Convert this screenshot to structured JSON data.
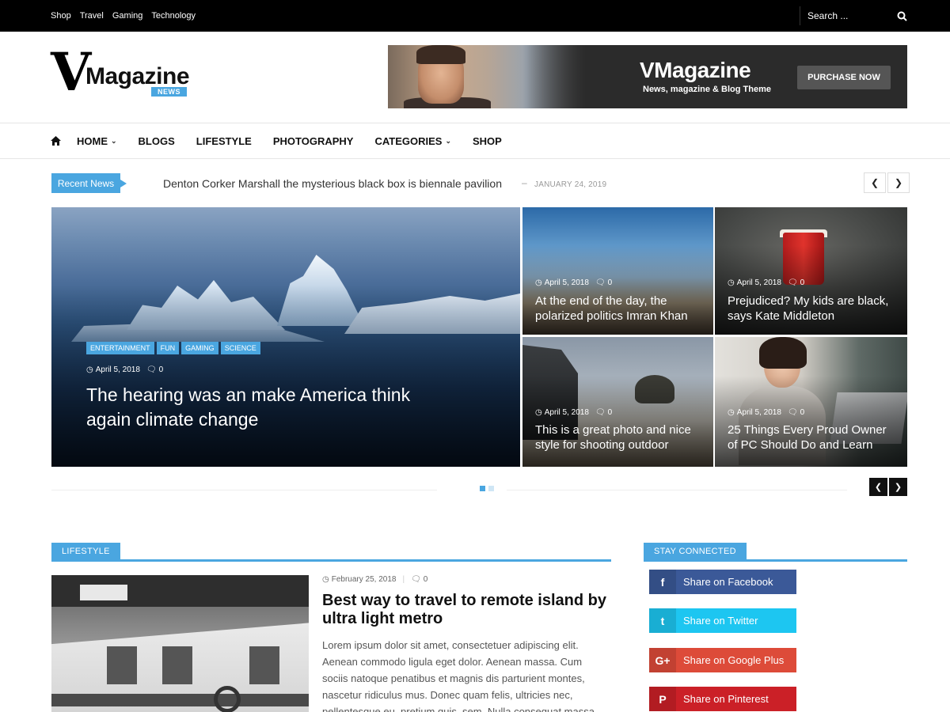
{
  "topbar": {
    "links": [
      "Shop",
      "Travel",
      "Gaming",
      "Technology"
    ],
    "search_placeholder": "Search ..."
  },
  "logo": {
    "letter": "V",
    "word": "Magazine",
    "badge": "NEWS"
  },
  "banner": {
    "title": "VMagazine",
    "tagline": "News, magazine & Blog Theme",
    "button": "PURCHASE NOW"
  },
  "nav": {
    "items": [
      {
        "label": "HOME",
        "dropdown": true
      },
      {
        "label": "BLOGS",
        "dropdown": false
      },
      {
        "label": "LIFESTYLE",
        "dropdown": false
      },
      {
        "label": "PHOTOGRAPHY",
        "dropdown": false
      },
      {
        "label": "CATEGORIES",
        "dropdown": true
      },
      {
        "label": "SHOP",
        "dropdown": false
      }
    ]
  },
  "ticker": {
    "label": "Recent News",
    "headline": "Denton Corker Marshall the mysterious black box is biennale pavilion",
    "separator": "–",
    "date": "JANUARY 24, 2019"
  },
  "slider": {
    "featured": {
      "categories": [
        "ENTERTAINMENT",
        "FUN",
        "GAMING",
        "SCIENCE"
      ],
      "date": "April 5, 2018",
      "comments": "0",
      "title": "The hearing was an make America think again climate change"
    },
    "tiles": [
      {
        "date": "April 5, 2018",
        "comments": "0",
        "title": "At the end of the day, the polarized politics Imran Khan"
      },
      {
        "date": "April 5, 2018",
        "comments": "0",
        "title": "Prejudiced? My kids are black, says Kate Middleton"
      },
      {
        "date": "April 5, 2018",
        "comments": "0",
        "title": "This is a great photo and nice style for shooting outdoor"
      },
      {
        "date": "April 5, 2018",
        "comments": "0",
        "title": "25 Things Every Proud Owner of PC Should Do and Learn"
      }
    ],
    "active_dot": 0,
    "dot_count": 2
  },
  "lifestyle": {
    "label": "LIFESTYLE",
    "post": {
      "date": "February 25, 2018",
      "comments": "0",
      "title": "Best way to travel to remote island by ultra light metro",
      "excerpt": "Lorem ipsum dolor sit amet, consectetuer adipiscing elit. Aenean commodo ligula eget dolor. Aenean massa. Cum sociis natoque penatibus et magnis dis parturient montes, nascetur ridiculus mus. Donec quam felis, ultricies nec, pellentesque eu, pretium quis, sem. Nulla consequat massa"
    }
  },
  "stay_connected": {
    "label": "STAY CONNECTED",
    "buttons": [
      {
        "label": "Share on Facebook",
        "icon": "facebook-icon",
        "glyph": "f",
        "color": "#3b5998"
      },
      {
        "label": "Share on Twitter",
        "icon": "twitter-icon",
        "glyph": "t",
        "color": "#1dc6f1"
      },
      {
        "label": "Share on Google Plus",
        "icon": "google-plus-icon",
        "glyph": "G+",
        "color": "#dd4b39"
      },
      {
        "label": "Share on Pinterest",
        "icon": "pinterest-icon",
        "glyph": "P",
        "color": "#cb2027"
      }
    ]
  },
  "colors": {
    "accent": "#4aa6e0",
    "topbar": "#000000",
    "dot_inactive": "#cfe6f5"
  }
}
